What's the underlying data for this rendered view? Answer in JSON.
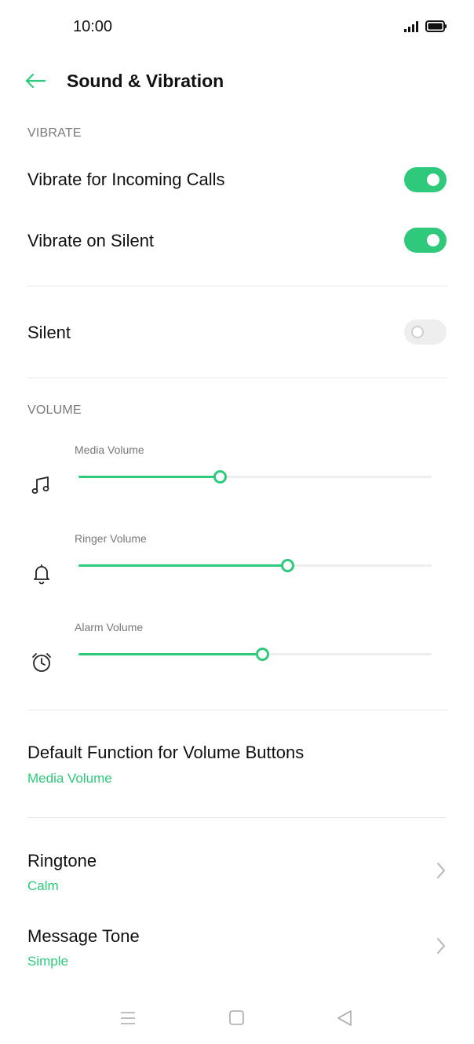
{
  "status_bar": {
    "time": "10:00",
    "signal_icon": "signal-icon",
    "battery_icon": "battery-icon"
  },
  "header": {
    "title": "Sound & Vibration",
    "back_icon": "arrow-left-icon"
  },
  "colors": {
    "accent": "#2ec97b",
    "text_primary": "#111111",
    "text_secondary": "#7a7a7a",
    "toggle_off": "#eeeeee"
  },
  "vibrate": {
    "header": "VIBRATE",
    "incoming_calls": {
      "label": "Vibrate for Incoming Calls",
      "enabled": true
    },
    "on_silent": {
      "label": "Vibrate on Silent",
      "enabled": true
    }
  },
  "silent": {
    "label": "Silent",
    "enabled": false
  },
  "volume": {
    "header": "VOLUME",
    "sliders": [
      {
        "label": "Media Volume",
        "icon": "music-note-icon",
        "level": 0.4
      },
      {
        "label": "Ringer Volume",
        "icon": "bell-icon",
        "level": 0.59
      },
      {
        "label": "Alarm Volume",
        "icon": "alarm-clock-icon",
        "level": 0.52
      }
    ]
  },
  "volume_buttons": {
    "label": "Default Function for Volume Buttons",
    "value": "Media Volume"
  },
  "ringtone": {
    "label": "Ringtone",
    "value": "Calm",
    "icon": "chevron-right-icon"
  },
  "message_tone": {
    "label": "Message Tone",
    "value": "Simple",
    "icon": "chevron-right-icon"
  },
  "nav_bar": {
    "menu_icon": "menu-icon",
    "home_icon": "home-icon",
    "back_icon": "back-triangle-icon"
  }
}
